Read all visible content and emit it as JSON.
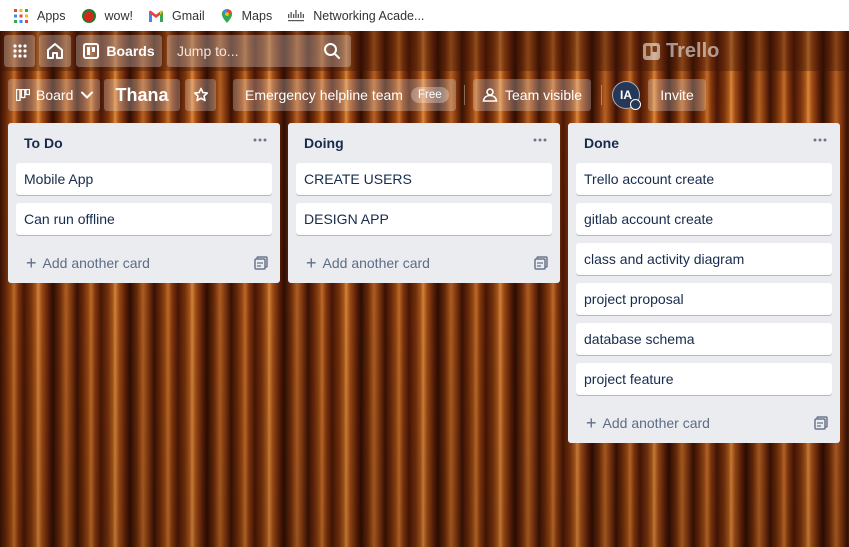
{
  "bookmarks": [
    {
      "label": "Apps",
      "icon": "apps-grid-icon"
    },
    {
      "label": "wow!",
      "icon": "wow-icon"
    },
    {
      "label": "Gmail",
      "icon": "gmail-icon"
    },
    {
      "label": "Maps",
      "icon": "maps-icon"
    },
    {
      "label": "Networking Acade...",
      "icon": "cisco-icon"
    }
  ],
  "header": {
    "boards_label": "Boards",
    "search_placeholder": "Jump to...",
    "logo_text": "Trello"
  },
  "board": {
    "menu_label": "Board",
    "title": "Thana",
    "team_name": "Emergency helpline team",
    "team_badge": "Free",
    "visibility": "Team visible",
    "avatar_initials": "IA",
    "invite_label": "Invite"
  },
  "lists": [
    {
      "title": "To Do",
      "cards": [
        "Mobile App",
        "Can run offline"
      ],
      "add_label": "Add another card"
    },
    {
      "title": "Doing",
      "cards": [
        "CREATE USERS",
        "DESIGN APP"
      ],
      "add_label": "Add another card"
    },
    {
      "title": "Done",
      "cards": [
        "Trello account create",
        "gitlab account create",
        "class and activity diagram",
        "project proposal",
        "database schema",
        "project feature"
      ],
      "add_label": "Add another card"
    }
  ],
  "colors": {
    "list_bg": "#ebecf0",
    "card_text": "#172b4d",
    "avatar_bg": "#253858"
  }
}
